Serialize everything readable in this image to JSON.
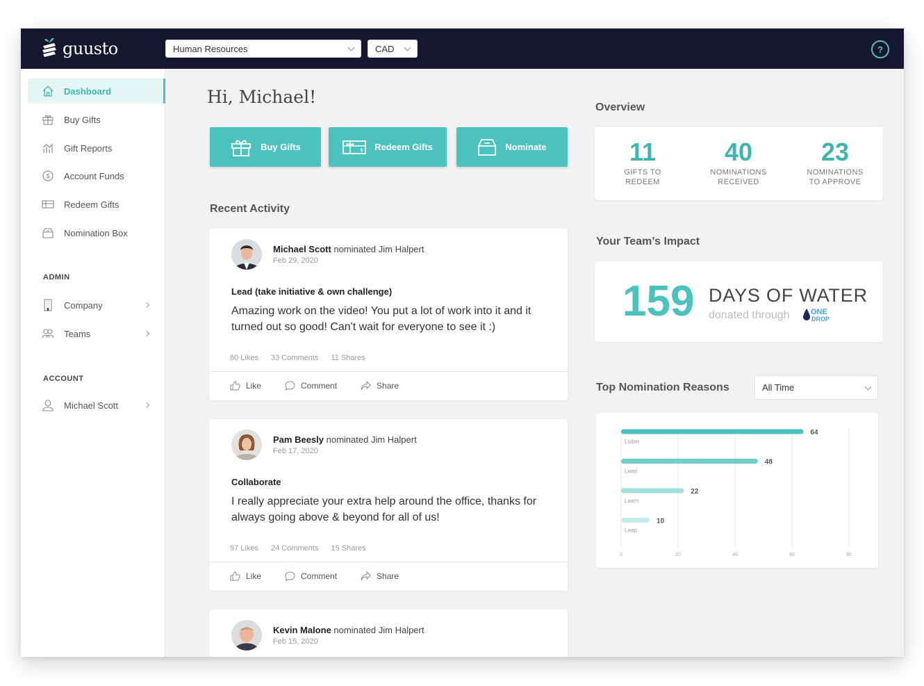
{
  "app": {
    "brand": "guusto",
    "department_select": "Human Resources",
    "currency_select": "CAD",
    "help": "?"
  },
  "sidebar": {
    "items": [
      {
        "label": "Dashboard",
        "icon": "home-icon"
      },
      {
        "label": "Buy Gifts",
        "icon": "gift-icon"
      },
      {
        "label": "Gift Reports",
        "icon": "chart-icon"
      },
      {
        "label": "Account Funds",
        "icon": "dollar-icon"
      },
      {
        "label": "Redeem Gifts",
        "icon": "gift-card-icon"
      },
      {
        "label": "Nomination Box",
        "icon": "ballot-box-icon"
      }
    ],
    "admin_heading": "ADMIN",
    "admin_items": [
      {
        "label": "Company",
        "icon": "building-icon"
      },
      {
        "label": "Teams",
        "icon": "team-icon"
      }
    ],
    "account_heading": "ACCOUNT",
    "account_items": [
      {
        "label": "Michael Scott",
        "icon": "user-icon"
      }
    ]
  },
  "main": {
    "greeting": "Hi, Michael!",
    "actions": [
      {
        "label": "Buy Gifts",
        "icon": "gift-icon"
      },
      {
        "label": "Redeem Gifts",
        "icon": "gift-card-icon"
      },
      {
        "label": "Nominate",
        "icon": "ballot-box-icon"
      }
    ],
    "recent_activity_title": "Recent Activity",
    "posts": [
      {
        "author": "Michael Scott",
        "verb": "nominated Jim Halpert",
        "date": "Feb 29, 2020",
        "reason": "Lead (take initiative & own challenge)",
        "message": "Amazing work on the video! You put a lot of work into it and it turned out so good! Can't wait for everyone to see it :)",
        "likes": "80 Likes",
        "comments": "33 Comments",
        "shares": "11 Shares"
      },
      {
        "author": "Pam Beesly",
        "verb": "nominated Jim Halpert",
        "date": "Feb 17, 2020",
        "reason": "Collaborate",
        "message": "I really appreciate your extra help around the office, thanks for always going above & beyond for all of us!",
        "likes": "97 Likes",
        "comments": "24 Comments",
        "shares": "15 Shares"
      },
      {
        "author": "Kevin Malone",
        "verb": "nominated Jim Halpert",
        "date": "Feb 15, 2020"
      }
    ],
    "post_actions": {
      "like": "Like",
      "comment": "Comment",
      "share": "Share"
    }
  },
  "overview": {
    "title": "Overview",
    "stats": [
      {
        "value": "11",
        "label_1": "GIFTS TO",
        "label_2": "REDEEM"
      },
      {
        "value": "40",
        "label_1": "NOMINATIONS",
        "label_2": "RECEIVED"
      },
      {
        "value": "23",
        "label_1": "NOMINATIONS",
        "label_2": "TO APPROVE"
      }
    ]
  },
  "impact": {
    "title": "Your Team’s Impact",
    "value": "159",
    "headline": "DAYS OF WATER",
    "subline": "donated through",
    "partner_logo": "ONE DROP"
  },
  "nomination_reasons": {
    "title": "Top Nomination Reasons",
    "filter": "All Time"
  },
  "chart_data": {
    "type": "bar",
    "orientation": "horizontal",
    "categories": [
      "Listen",
      "Lead",
      "Learn",
      "Leap"
    ],
    "values": [
      64,
      48,
      22,
      10
    ],
    "xlim": [
      0,
      80
    ],
    "xticks": [
      "0",
      "20",
      "40",
      "60",
      "80"
    ],
    "grid": true,
    "colors": [
      "#4bc2bd",
      "#6dcfca",
      "#9fdfdc",
      "#c4ecea"
    ]
  },
  "colors": {
    "accent": "#4bc2bd",
    "topbar": "#161630",
    "background": "#f2f2f2"
  }
}
